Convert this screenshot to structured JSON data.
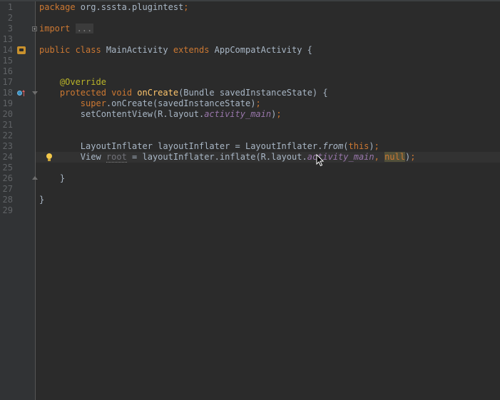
{
  "editor": {
    "line_numbers": [
      "1",
      "2",
      "3",
      "13",
      "14",
      "15",
      "16",
      "17",
      "18",
      "19",
      "20",
      "21",
      "22",
      "23",
      "24",
      "25",
      "26",
      "27",
      "28",
      "29"
    ],
    "lines": [
      {
        "num": "1",
        "segments": [
          {
            "t": "package ",
            "c": "kw"
          },
          {
            "t": "org.sssta.plugintest",
            "c": ""
          },
          {
            "t": ";",
            "c": "kw"
          }
        ]
      },
      {
        "num": "2",
        "segments": []
      },
      {
        "num": "3",
        "segments": [
          {
            "t": "import ",
            "c": "kw"
          },
          {
            "t": "...",
            "c": "folded"
          }
        ]
      },
      {
        "num": "13",
        "segments": []
      },
      {
        "num": "14",
        "segments": [
          {
            "t": "public class ",
            "c": "kw"
          },
          {
            "t": "MainActivity ",
            "c": ""
          },
          {
            "t": "extends ",
            "c": "kw"
          },
          {
            "t": "AppCompatActivity {",
            "c": ""
          }
        ]
      },
      {
        "num": "15",
        "segments": []
      },
      {
        "num": "16",
        "segments": []
      },
      {
        "num": "17",
        "segments": [
          {
            "t": "    ",
            "c": ""
          },
          {
            "t": "@Override",
            "c": "ann"
          }
        ]
      },
      {
        "num": "18",
        "segments": [
          {
            "t": "    ",
            "c": ""
          },
          {
            "t": "protected void ",
            "c": "kw"
          },
          {
            "t": "onCreate",
            "c": "fn"
          },
          {
            "t": "(Bundle savedInstanceState) {",
            "c": ""
          }
        ]
      },
      {
        "num": "19",
        "segments": [
          {
            "t": "        ",
            "c": ""
          },
          {
            "t": "super",
            "c": "kw"
          },
          {
            "t": ".onCreate(savedInstanceState)",
            "c": ""
          },
          {
            "t": ";",
            "c": "kw"
          }
        ]
      },
      {
        "num": "20",
        "segments": [
          {
            "t": "        setContentView(R.layout.",
            "c": ""
          },
          {
            "t": "activity_main",
            "c": "ital"
          },
          {
            "t": ")",
            "c": ""
          },
          {
            "t": ";",
            "c": "kw"
          }
        ]
      },
      {
        "num": "21",
        "segments": []
      },
      {
        "num": "22",
        "segments": []
      },
      {
        "num": "23",
        "segments": [
          {
            "t": "        LayoutInflater layoutInflater = LayoutInflater.",
            "c": ""
          },
          {
            "t": "from",
            "c": "ital-plain"
          },
          {
            "t": "(",
            "c": ""
          },
          {
            "t": "this",
            "c": "kw"
          },
          {
            "t": ")",
            "c": ""
          },
          {
            "t": ";",
            "c": "kw"
          }
        ]
      },
      {
        "num": "24",
        "segments": [
          {
            "t": "        View ",
            "c": ""
          },
          {
            "t": "root",
            "c": "unused"
          },
          {
            "t": " = layoutInflater.inflate(R.layout.",
            "c": ""
          },
          {
            "t": "activity_main",
            "c": "ital"
          },
          {
            "t": ", ",
            "c": "kw"
          },
          {
            "t": "null",
            "c": "kw nullhl"
          },
          {
            "t": ")",
            "c": ""
          },
          {
            "t": ";",
            "c": "kw"
          }
        ]
      },
      {
        "num": "25",
        "segments": []
      },
      {
        "num": "26",
        "segments": [
          {
            "t": "    }",
            "c": ""
          }
        ]
      },
      {
        "num": "27",
        "segments": []
      },
      {
        "num": "28",
        "segments": [
          {
            "t": "}",
            "c": ""
          }
        ]
      },
      {
        "num": "29",
        "segments": []
      }
    ],
    "current_line": "24",
    "gutter_icons": {
      "fold_import": "plus-fold-icon",
      "class_marker": "android-activity-icon",
      "override_marker": "override-method-icon",
      "intention": "lightbulb-icon"
    }
  },
  "colors": {
    "background": "#2b2b2b",
    "gutter": "#313335",
    "keyword": "#cc7832",
    "annotation": "#bbb529",
    "method": "#ffc66d",
    "field": "#9876aa",
    "text": "#a9b7c6"
  }
}
